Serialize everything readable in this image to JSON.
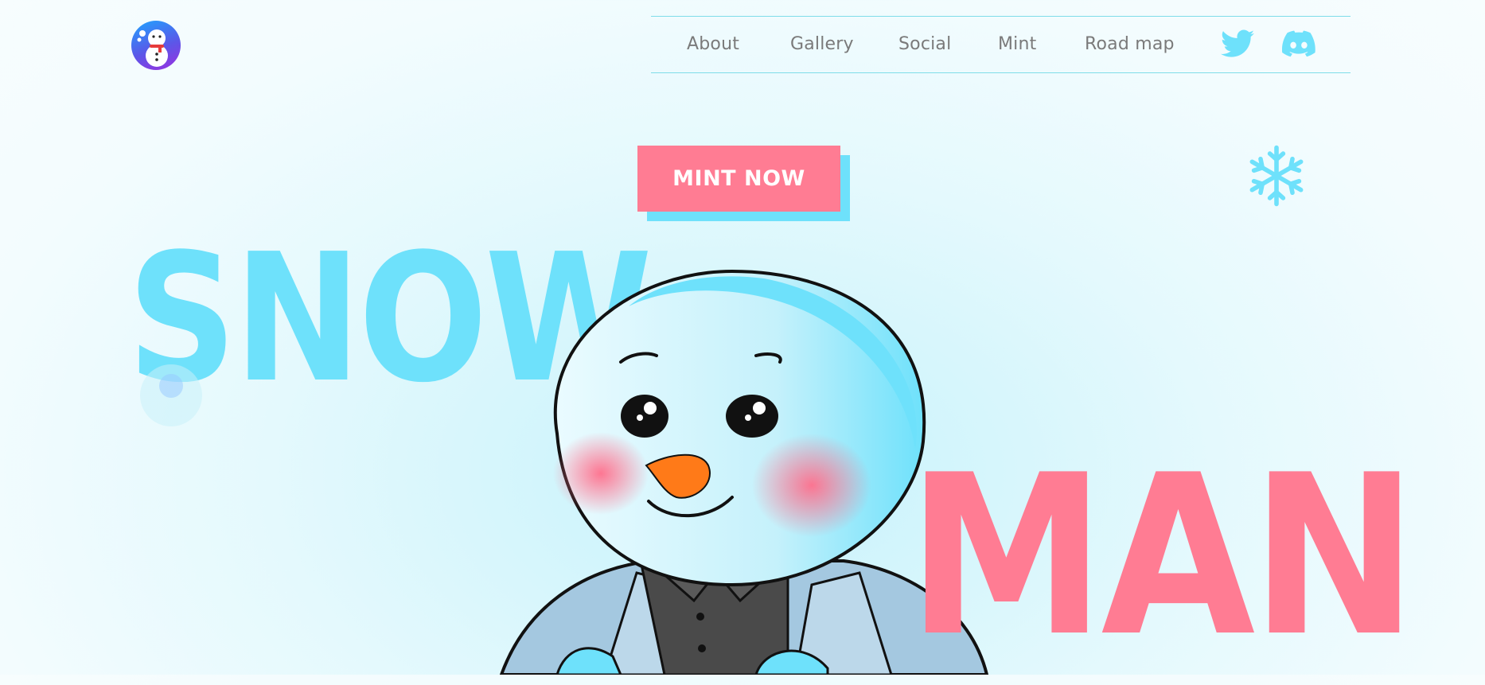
{
  "nav": {
    "links": [
      "About",
      "Gallery",
      "Social",
      "Mint",
      "Road map"
    ],
    "social": [
      "twitter-icon",
      "discord-icon"
    ]
  },
  "hero": {
    "cta_label": "MINT NOW",
    "title_word_1": "SNOW",
    "title_word_2": "MAN"
  },
  "colors": {
    "primary_blue": "#6ee1fb",
    "primary_pink": "#ff7c93",
    "nav_text": "#7a7a7a",
    "background": "#e4f9fd"
  }
}
